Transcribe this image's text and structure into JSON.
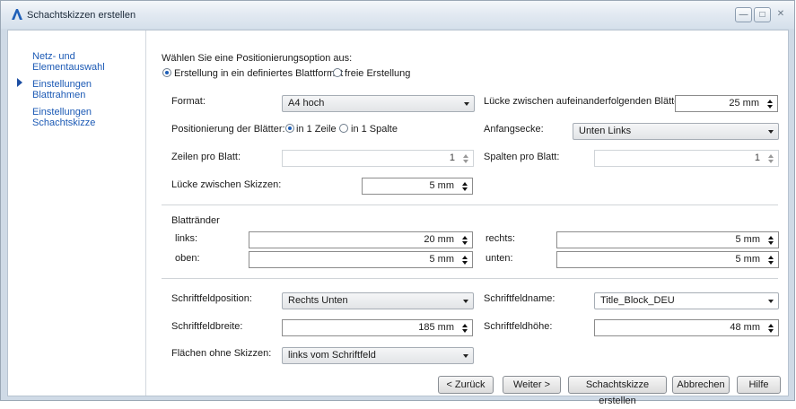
{
  "window": {
    "title": "Schachtskizzen erstellen"
  },
  "nav": {
    "items": [
      {
        "label": "Netz- und Elementauswahl"
      },
      {
        "label": "Einstellungen Blattrahmen"
      },
      {
        "label": "Einstellungen Schachtskizze"
      }
    ]
  },
  "positioning": {
    "heading": "Wählen Sie eine Positionierungsoption aus:",
    "option_defined": "Erstellung in ein definiertes Blattformat",
    "option_free": "freie Erstellung"
  },
  "format": {
    "label": "Format:",
    "value": "A4 hoch"
  },
  "gap_sheets": {
    "label": "Lücke zwischen aufeinanderfolgenden Blättern:",
    "value": "25 mm"
  },
  "sheet_positioning": {
    "label": "Positionierung der Blätter:",
    "row": "in 1 Zeile",
    "column": "in 1 Spalte"
  },
  "start_corner": {
    "label": "Anfangsecke:",
    "value": "Unten Links"
  },
  "rows": {
    "label": "Zeilen pro Blatt:",
    "value": "1"
  },
  "cols": {
    "label": "Spalten pro Blatt:",
    "value": "1"
  },
  "gap_sketches": {
    "label": "Lücke zwischen Skizzen:",
    "value": "5 mm"
  },
  "margins": {
    "heading": "Blattränder",
    "left": {
      "label": "links:",
      "value": "20 mm"
    },
    "right": {
      "label": "rechts:",
      "value": "5 mm"
    },
    "top": {
      "label": "oben:",
      "value": "5 mm"
    },
    "bottom": {
      "label": "unten:",
      "value": "5 mm"
    }
  },
  "titleblock": {
    "position": {
      "label": "Schriftfeldposition:",
      "value": "Rechts Unten"
    },
    "name": {
      "label": "Schriftfeldname:",
      "value": "Title_Block_DEU"
    },
    "width": {
      "label": "Schriftfeldbreite:",
      "value": "185 mm"
    },
    "height": {
      "label": "Schriftfeldhöhe:",
      "value": "48 mm"
    },
    "areas": {
      "label": "Flächen ohne Skizzen:",
      "value": "links vom Schriftfeld"
    }
  },
  "buttons": {
    "back": "< Zurück",
    "next": "Weiter >",
    "create": "Schachtskizze erstellen",
    "cancel": "Abbrechen",
    "help": "Hilfe"
  }
}
